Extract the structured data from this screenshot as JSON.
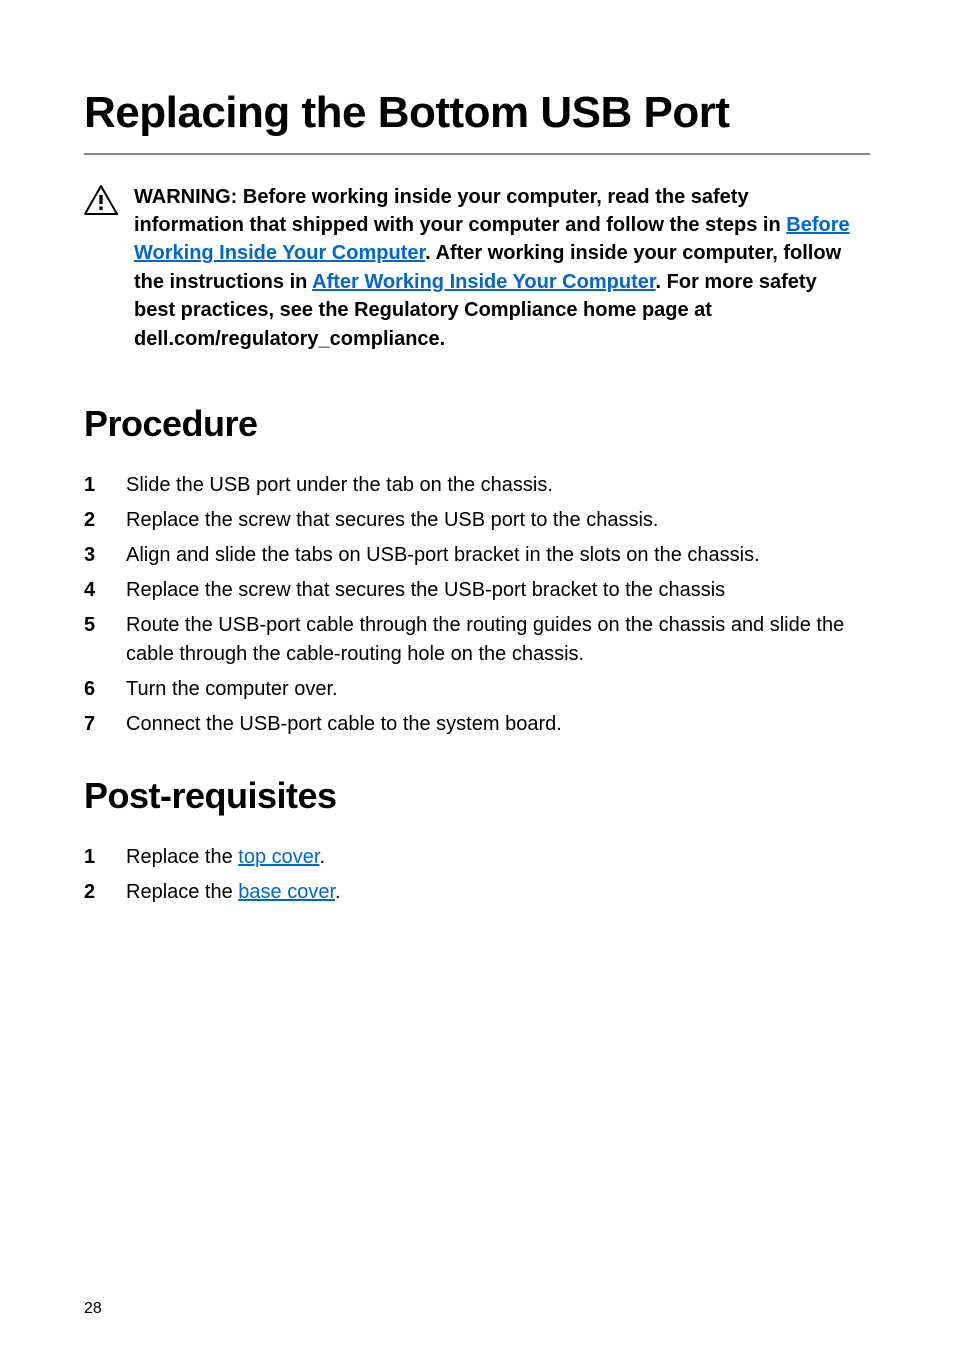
{
  "title": "Replacing the Bottom USB Port",
  "warning": {
    "pre": "WARNING: Before working inside your computer, read the safety information that shipped with your computer and follow the steps in ",
    "link1": "Before Working Inside Your Computer",
    "mid1": ". After working inside your computer, follow the instructions in ",
    "link2": "After Working Inside Your Computer",
    "post": ". For more safety best practices, see the Regulatory Compliance home page at dell.com/regulatory_compliance."
  },
  "procedure": {
    "heading": "Procedure",
    "steps": [
      "Slide the USB port under the tab on the chassis.",
      "Replace the screw that secures the USB port to the chassis.",
      "Align and slide the tabs on USB-port bracket in the slots on the chassis.",
      "Replace the screw that secures the USB-port bracket to the chassis",
      "Route the USB-port cable through the routing guides on the chassis and slide the cable through the cable-routing hole on the chassis.",
      "Turn the computer over.",
      "Connect the USB-port cable to the system board."
    ]
  },
  "postreq": {
    "heading": "Post-requisites",
    "steps": [
      {
        "pre": "Replace the ",
        "link": "top cover",
        "post": "."
      },
      {
        "pre": "Replace the ",
        "link": "base cover",
        "post": "."
      }
    ]
  },
  "page_number": "28"
}
